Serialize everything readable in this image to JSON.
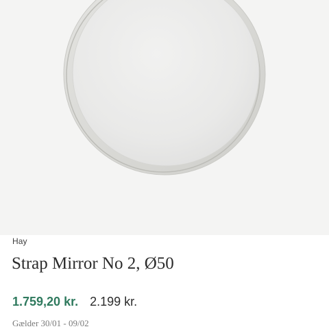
{
  "product": {
    "brand": "Hay",
    "title": "Strap Mirror No 2, Ø50",
    "sale_price": "1.759,20 kr.",
    "regular_price": "2.199 kr.",
    "validity": "Gælder 30/01 - 09/02"
  },
  "colors": {
    "sale_price": "#2f7a5e",
    "image_background": "#f4f4f3",
    "mirror_frame": "#dededb",
    "mirror_glass": "#ececeb"
  }
}
